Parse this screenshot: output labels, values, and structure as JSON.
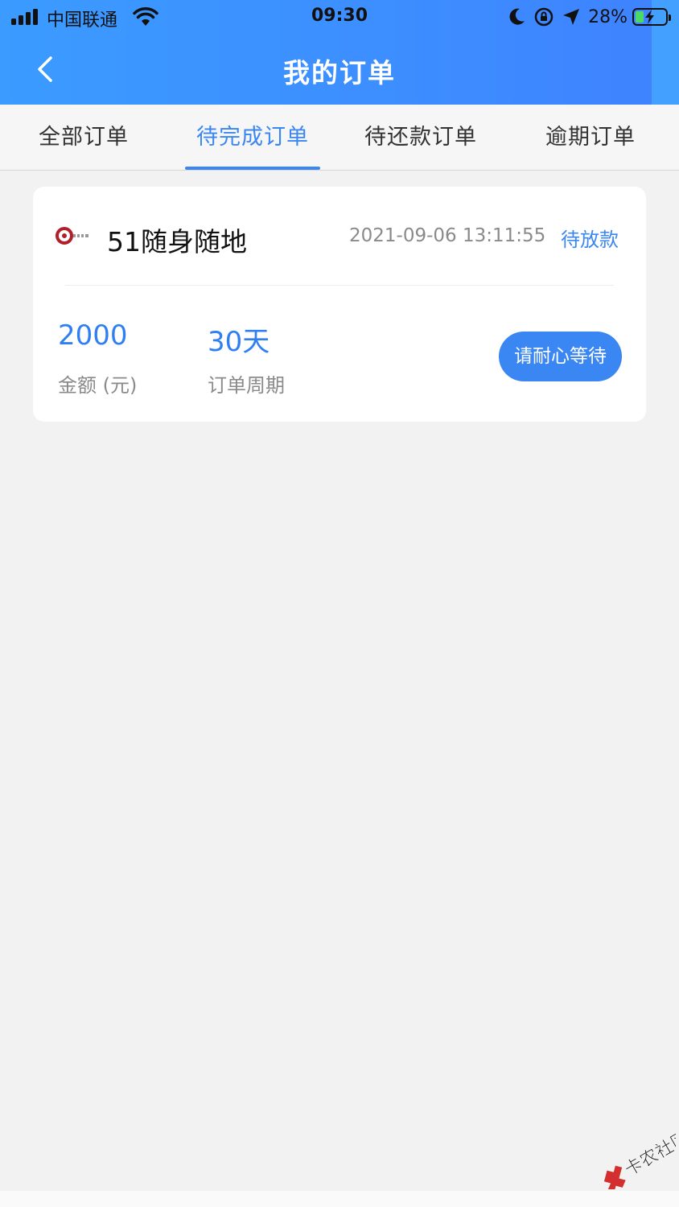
{
  "status_bar": {
    "carrier": "中国联通",
    "time": "09:30",
    "battery_percent": "28%",
    "battery_level": 0.28
  },
  "nav": {
    "title": "我的订单",
    "back_icon": "chevron-left-icon"
  },
  "tabs": [
    {
      "label": "全部订单",
      "active": false
    },
    {
      "label": "待完成订单",
      "active": true
    },
    {
      "label": "待还款订单",
      "active": false
    },
    {
      "label": "逾期订单",
      "active": false
    }
  ],
  "order": {
    "merchant": "51随身随地",
    "time": "2021-09-06 13:11:55",
    "status": "待放款",
    "amount": "2000",
    "amount_label": "金额 (元)",
    "period": "30天",
    "period_label": "订单周期",
    "action_label": "请耐心等待"
  },
  "watermark": {
    "text": "卡农社区"
  },
  "colors": {
    "accent": "#3a86f2",
    "header": "#3d8dff",
    "background": "#f2f2f2"
  }
}
